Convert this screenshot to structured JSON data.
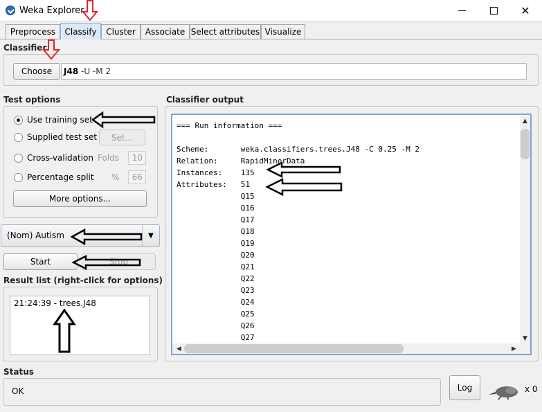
{
  "window": {
    "title": "Weka Explorer",
    "minimize": "—",
    "maximize": "☐",
    "close": "✕"
  },
  "tabs": [
    "Preprocess",
    "Classify",
    "Cluster",
    "Associate",
    "Select attributes",
    "Visualize"
  ],
  "active_tab": "Classify",
  "classifier": {
    "section_title": "Classifier",
    "choose_label": "Choose",
    "name": "J48",
    "options": " -U -M 2"
  },
  "test_options": {
    "section_title": "Test options",
    "use_training_set": "Use training set",
    "supplied_test_set": "Supplied test set",
    "set_button": "Set...",
    "cross_validation": "Cross-validation",
    "folds_label": "Folds",
    "folds_value": "10",
    "percentage_split": "Percentage split",
    "percent_label": "%",
    "percent_value": "66",
    "more_options": "More options...",
    "selected": "use_training_set"
  },
  "class_attribute": {
    "value": "(Nom) Autism"
  },
  "actions": {
    "start": "Start",
    "stop": "Stop"
  },
  "result_list": {
    "section_title": "Result list (right-click for options)",
    "items": [
      "21:24:39 - trees.J48"
    ]
  },
  "classifier_output": {
    "section_title": "Classifier output",
    "lines": [
      "=== Run information ===",
      "",
      "Scheme:       weka.classifiers.trees.J48 -C 0.25 -M 2",
      "Relation:     RapidMinerData",
      "Instances:    135",
      "Attributes:   51",
      "              Q15",
      "              Q16",
      "              Q17",
      "              Q18",
      "              Q19",
      "              Q20",
      "              Q21",
      "              Q22",
      "              Q23",
      "              Q24",
      "              Q25",
      "              Q26",
      "              Q27"
    ]
  },
  "status": {
    "section_title": "Status",
    "text": "OK",
    "log_button": "Log",
    "count": "x 0"
  },
  "colors": {
    "active_tab": "#dce9f7",
    "annotation_red": "#e0262b",
    "annotation_black": "#000000"
  }
}
